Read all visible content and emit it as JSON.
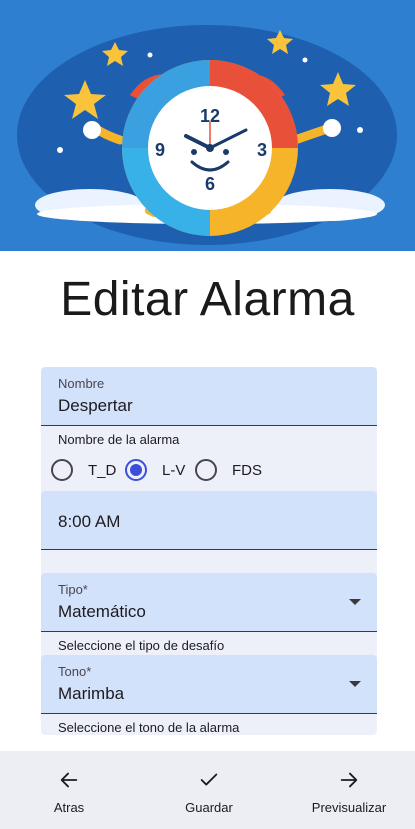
{
  "page": {
    "title": "Editar Alarma"
  },
  "form": {
    "name_field": {
      "label": "Nombre",
      "value": "Despertar",
      "helper": "Nombre de la alarma"
    },
    "days": {
      "options": [
        {
          "label": "T_D",
          "checked": false
        },
        {
          "label": "L-V",
          "checked": true
        },
        {
          "label": "FDS",
          "checked": false
        }
      ]
    },
    "time_field": {
      "value": "8:00 AM"
    },
    "tipo_field": {
      "label": "Tipo*",
      "value": "Matemático",
      "helper": "Seleccione el tipo de desafío"
    },
    "tono_field": {
      "label": "Tono*",
      "value": "Marimba",
      "helper": "Seleccione el tono de la alarma"
    }
  },
  "bottom_nav": {
    "back_label": "Atras",
    "save_label": "Guardar",
    "preview_label": "Previsualizar"
  },
  "colors": {
    "hero_background": "#2f7fd0",
    "field_fill": "#d3e2fb",
    "card_background": "#eef0f9",
    "accent": "#3d4fd9",
    "bottom_bar": "#eceef4"
  },
  "icons": {
    "hero": "alarm-clock-illustration",
    "back": "arrow-left-icon",
    "save": "check-icon",
    "preview": "arrow-right-icon",
    "dropdown": "dropdown-arrow-icon"
  }
}
